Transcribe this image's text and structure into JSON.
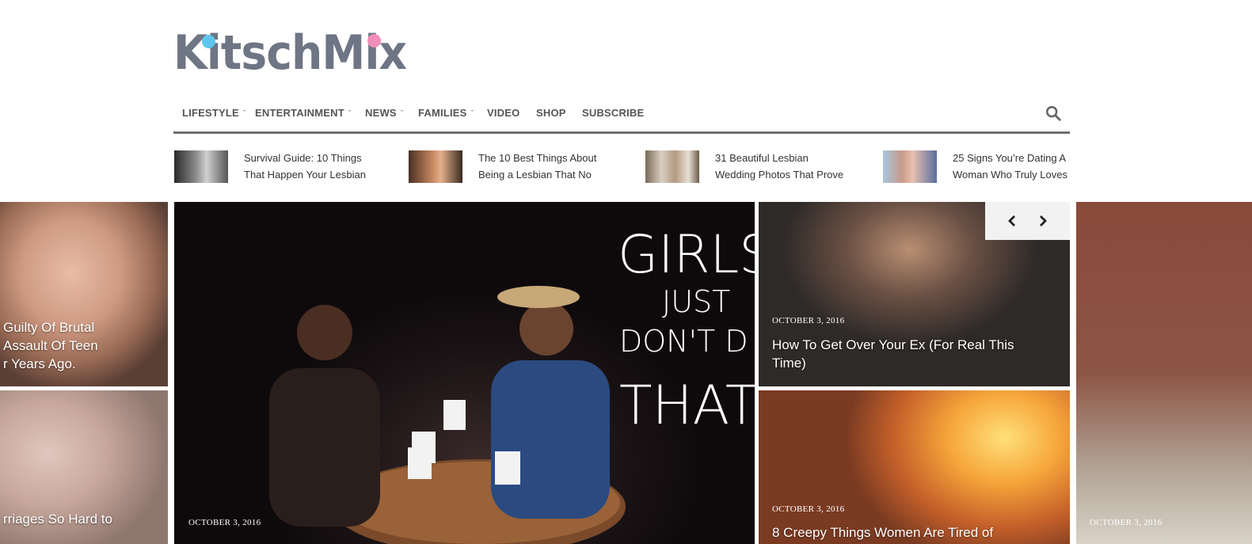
{
  "logo": {
    "text": "KitschMix"
  },
  "nav": {
    "items": [
      {
        "label": "LIFESTYLE",
        "has_dropdown": true
      },
      {
        "label": "ENTERTAINMENT",
        "has_dropdown": true
      },
      {
        "label": "NEWS",
        "has_dropdown": true
      },
      {
        "label": "FAMILIES",
        "has_dropdown": true
      },
      {
        "label": "VIDEO",
        "has_dropdown": false
      },
      {
        "label": "SHOP",
        "has_dropdown": false
      },
      {
        "label": "SUBSCRIBE",
        "has_dropdown": false
      }
    ],
    "search_icon": "search-icon"
  },
  "ticker": [
    {
      "line1": "Survival Guide: 10 Things",
      "line2": "That Happen Your Lesbian"
    },
    {
      "line1": "The 10 Best Things About",
      "line2": "Being a Lesbian That No"
    },
    {
      "line1": "31 Beautiful Lesbian",
      "line2": "Wedding Photos That Prove"
    },
    {
      "line1": "25 Signs You’re Dating A",
      "line2": "Woman Who Truly Loves"
    }
  ],
  "tiles": {
    "left1": {
      "title_lines": [
        "Guilty Of Brutal",
        "Assault Of Teen",
        "r Years Ago."
      ]
    },
    "left2": {
      "title_lines": [
        "rriages So Hard to"
      ]
    },
    "main": {
      "date": "OCTOBER 3, 2016",
      "overlay_lines": [
        "GIRLS",
        "JUST",
        "DON'T  D",
        "THAT"
      ]
    },
    "right1": {
      "date": "OCTOBER 3, 2016",
      "title_lines": [
        "How To Get Over Your Ex (For Real This",
        "Time)"
      ]
    },
    "right2": {
      "date": "OCTOBER 3, 2016",
      "title_lines": [
        "8 Creepy Things Women Are Tired of"
      ]
    },
    "far": {
      "date": "OCTOBER 3, 2016"
    }
  },
  "slider": {
    "prev_icon": "chevron-left-icon",
    "next_icon": "chevron-right-icon"
  },
  "colors": {
    "logo_gray": "#6e7584",
    "dot_blue": "#5ec6ee",
    "dot_pink": "#f08fb9",
    "nav_rule": "#6e6e6e"
  }
}
